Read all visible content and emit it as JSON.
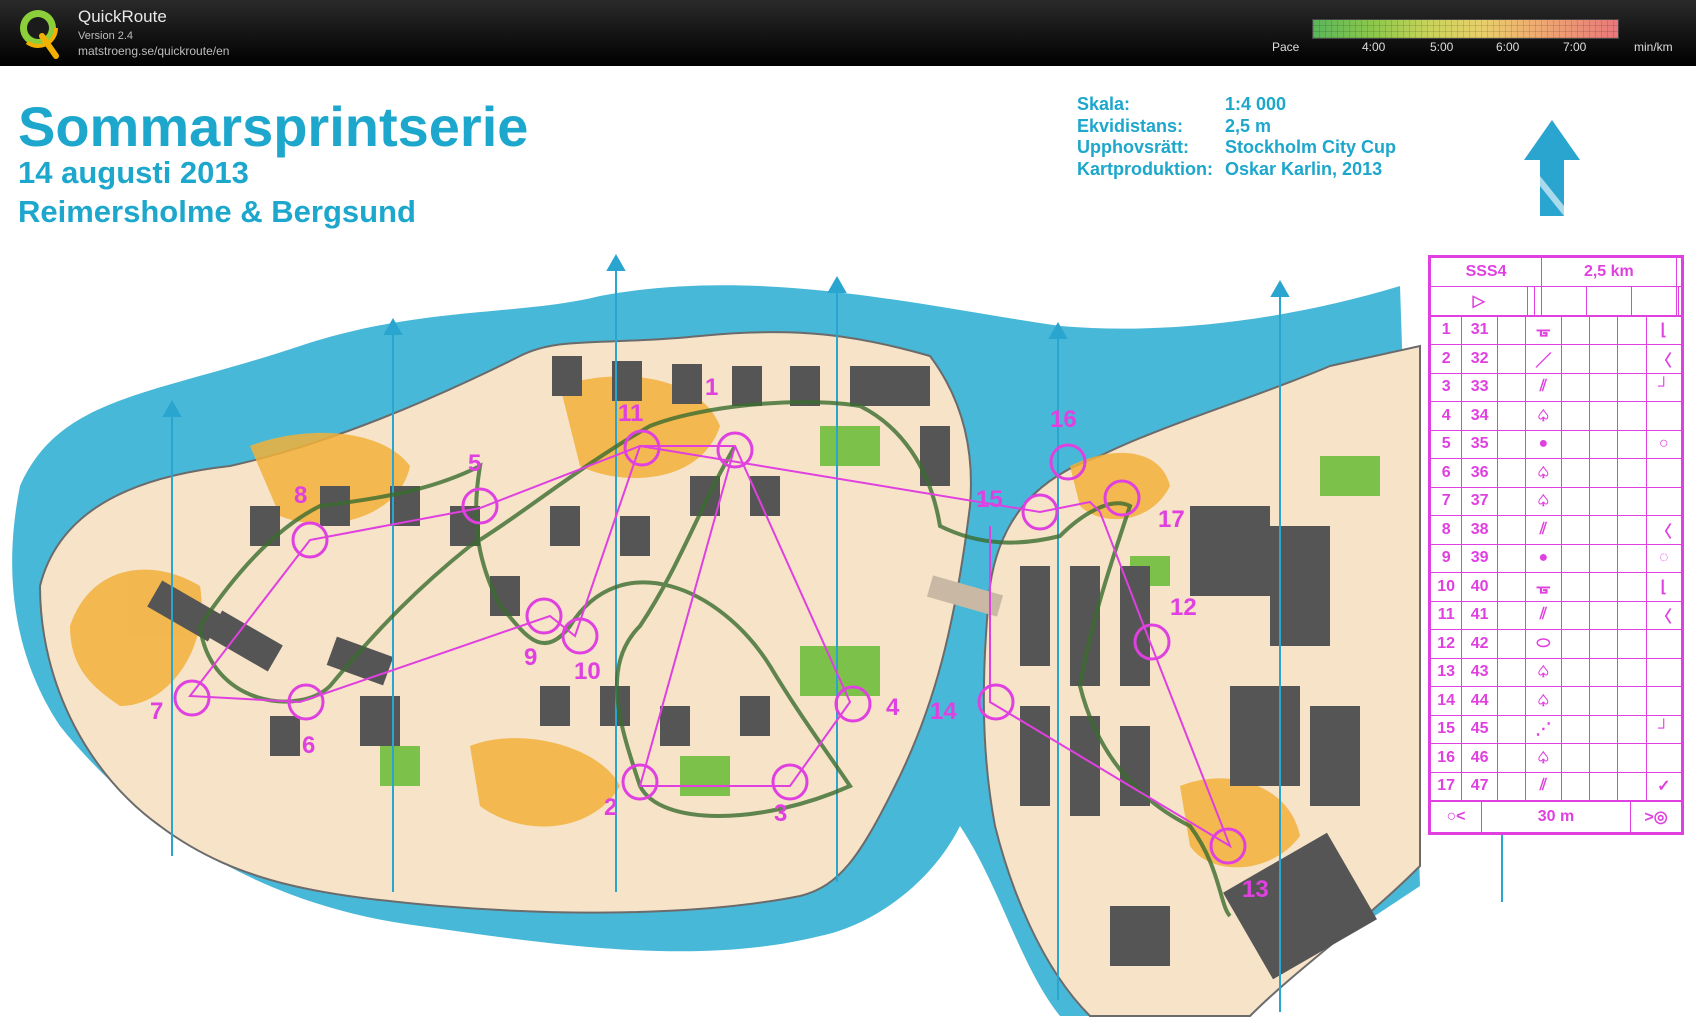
{
  "app": {
    "name": "QuickRoute",
    "version": "Version 2.4",
    "url": "matstroeng.se/quickroute/en"
  },
  "pace": {
    "label": "Pace",
    "ticks": [
      "4:00",
      "5:00",
      "6:00",
      "7:00"
    ],
    "unit": "min/km"
  },
  "map": {
    "title": "Sommarsprintserie",
    "date": "14 augusti 2013",
    "area": "Reimersholme & Bergsund",
    "info": [
      {
        "key": "Skala:",
        "value": "1:4 000"
      },
      {
        "key": "Ekvidistans:",
        "value": "2,5 m"
      },
      {
        "key": "Upphovsrätt:",
        "value": "Stockholm City Cup"
      },
      {
        "key": "Kartproduktion:",
        "value": "Oskar Karlin, 2013"
      }
    ],
    "control_labels": [
      "1",
      "2",
      "3",
      "4",
      "5",
      "6",
      "7",
      "8",
      "9",
      "10",
      "11",
      "12",
      "13",
      "14",
      "15",
      "16",
      "17"
    ]
  },
  "description_sheet": {
    "course": "SSS4",
    "length": "2,5 km",
    "rows": [
      {
        "n": "1",
        "code": "31",
        "feature": "fence",
        "detail": "foot"
      },
      {
        "n": "2",
        "code": "32",
        "feature": "path",
        "detail": "corner"
      },
      {
        "n": "3",
        "code": "33",
        "feature": "cliff",
        "detail": "top"
      },
      {
        "n": "4",
        "code": "34",
        "feature": "tree",
        "detail": ""
      },
      {
        "n": "5",
        "code": "35",
        "feature": "dot",
        "detail": "loop"
      },
      {
        "n": "6",
        "code": "36",
        "feature": "tree",
        "detail": ""
      },
      {
        "n": "7",
        "code": "37",
        "feature": "tree",
        "detail": ""
      },
      {
        "n": "8",
        "code": "38",
        "feature": "cliff",
        "detail": "corner"
      },
      {
        "n": "9",
        "code": "39",
        "feature": "dot",
        "detail": "side"
      },
      {
        "n": "10",
        "code": "40",
        "feature": "fence",
        "detail": "foot"
      },
      {
        "n": "11",
        "code": "41",
        "feature": "cliff",
        "detail": "corner"
      },
      {
        "n": "12",
        "code": "42",
        "feature": "oval",
        "detail": ""
      },
      {
        "n": "13",
        "code": "43",
        "feature": "tree",
        "detail": ""
      },
      {
        "n": "14",
        "code": "44",
        "feature": "tree",
        "detail": ""
      },
      {
        "n": "15",
        "code": "45",
        "feature": "steps",
        "detail": "top"
      },
      {
        "n": "16",
        "code": "46",
        "feature": "tree",
        "detail": ""
      },
      {
        "n": "17",
        "code": "47",
        "feature": "cliff",
        "detail": "check"
      }
    ],
    "finish": "30 m"
  },
  "colors": {
    "water": "#48b8d8",
    "course": "#e040e0",
    "title": "#1da7cc",
    "route": "#3b6b2e",
    "open": "#f2b03a",
    "building": "#555555"
  }
}
